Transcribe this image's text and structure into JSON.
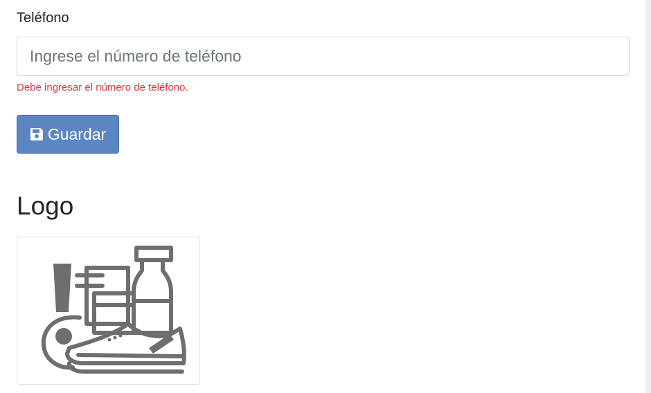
{
  "form": {
    "phone_label": "Teléfono",
    "phone_value": "",
    "phone_placeholder": "Ingrese el número de teléfono",
    "phone_error": "Debe ingresar el número de teléfono.",
    "save_label": "Guardar",
    "save_icon": "floppy-disk-icon"
  },
  "logo": {
    "heading": "Logo",
    "image_icon": "products-shoe-bottle-icon"
  },
  "colors": {
    "error": "#dc3545",
    "primary_button": "#5b86c2",
    "icon_gray": "#6e6e6e"
  }
}
